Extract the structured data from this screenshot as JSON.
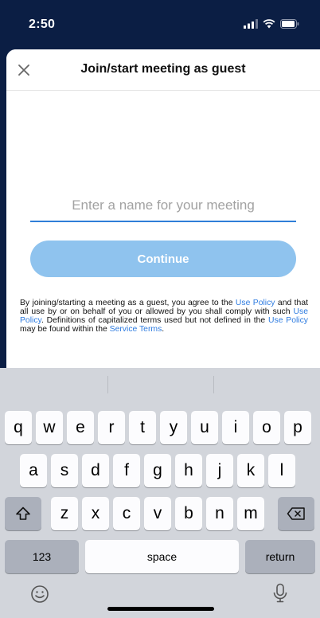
{
  "status_bar": {
    "time": "2:50"
  },
  "nav": {
    "title": "Join/start meeting as guest"
  },
  "form": {
    "name_placeholder": "Enter a name for your meeting",
    "name_value": "",
    "continue_label": "Continue"
  },
  "legal": {
    "t1": "By joining/starting a meeting as a guest, you agree to the ",
    "link1": "Use Policy",
    "t2": " and that all use by or on behalf of you or allowed by you shall comply with such ",
    "link2": "Use Policy",
    "t3": ". Definitions of capitalized terms used but not defined in the ",
    "link3": "Use Policy",
    "t4": " may be found within the ",
    "link4": "Service Terms",
    "t5": "."
  },
  "keyboard": {
    "row1": [
      "q",
      "w",
      "e",
      "r",
      "t",
      "y",
      "u",
      "i",
      "o",
      "p"
    ],
    "row2": [
      "a",
      "s",
      "d",
      "f",
      "g",
      "h",
      "j",
      "k",
      "l"
    ],
    "row3": [
      "z",
      "x",
      "c",
      "v",
      "b",
      "n",
      "m"
    ],
    "numbers_label": "123",
    "space_label": "space",
    "return_label": "return"
  },
  "colors": {
    "accent": "#2f7ed8",
    "button_disabled": "#8fc3ee",
    "status_bg": "#0b1e44"
  }
}
